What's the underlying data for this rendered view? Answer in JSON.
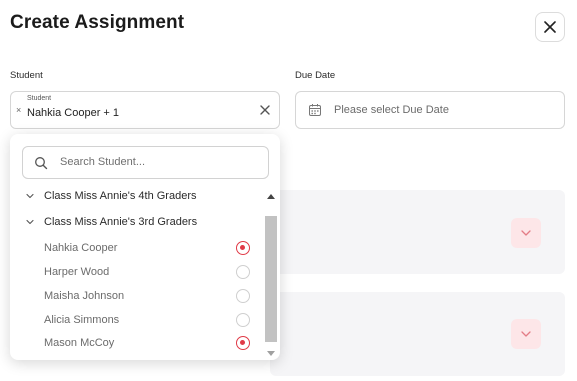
{
  "title": "Create Assignment",
  "student": {
    "label": "Student",
    "mini_label": "Student",
    "value": "Nahkia Cooper  + 1"
  },
  "due_date": {
    "label": "Due Date",
    "placeholder": "Please select Due Date"
  },
  "dropdown": {
    "search_placeholder": "Search Student...",
    "groups": [
      {
        "label": "Class Miss Annie's 4th Graders"
      },
      {
        "label": "Class Miss Annie's 3rd Graders"
      }
    ],
    "students": [
      {
        "name": "Nahkia Cooper",
        "selected": true
      },
      {
        "name": "Harper Wood",
        "selected": false
      },
      {
        "name": "Maisha Johnson",
        "selected": false
      },
      {
        "name": "Alicia Simmons",
        "selected": false
      },
      {
        "name": "Mason McCoy",
        "selected": true
      }
    ]
  },
  "colors": {
    "accent": "#e03a47",
    "accent_light": "#fde6e8",
    "card_bg": "#f5f5f7"
  },
  "icons": {
    "close": "close-icon",
    "calendar": "calendar-icon",
    "search": "search-icon",
    "chevron": "chevron-down-icon"
  }
}
